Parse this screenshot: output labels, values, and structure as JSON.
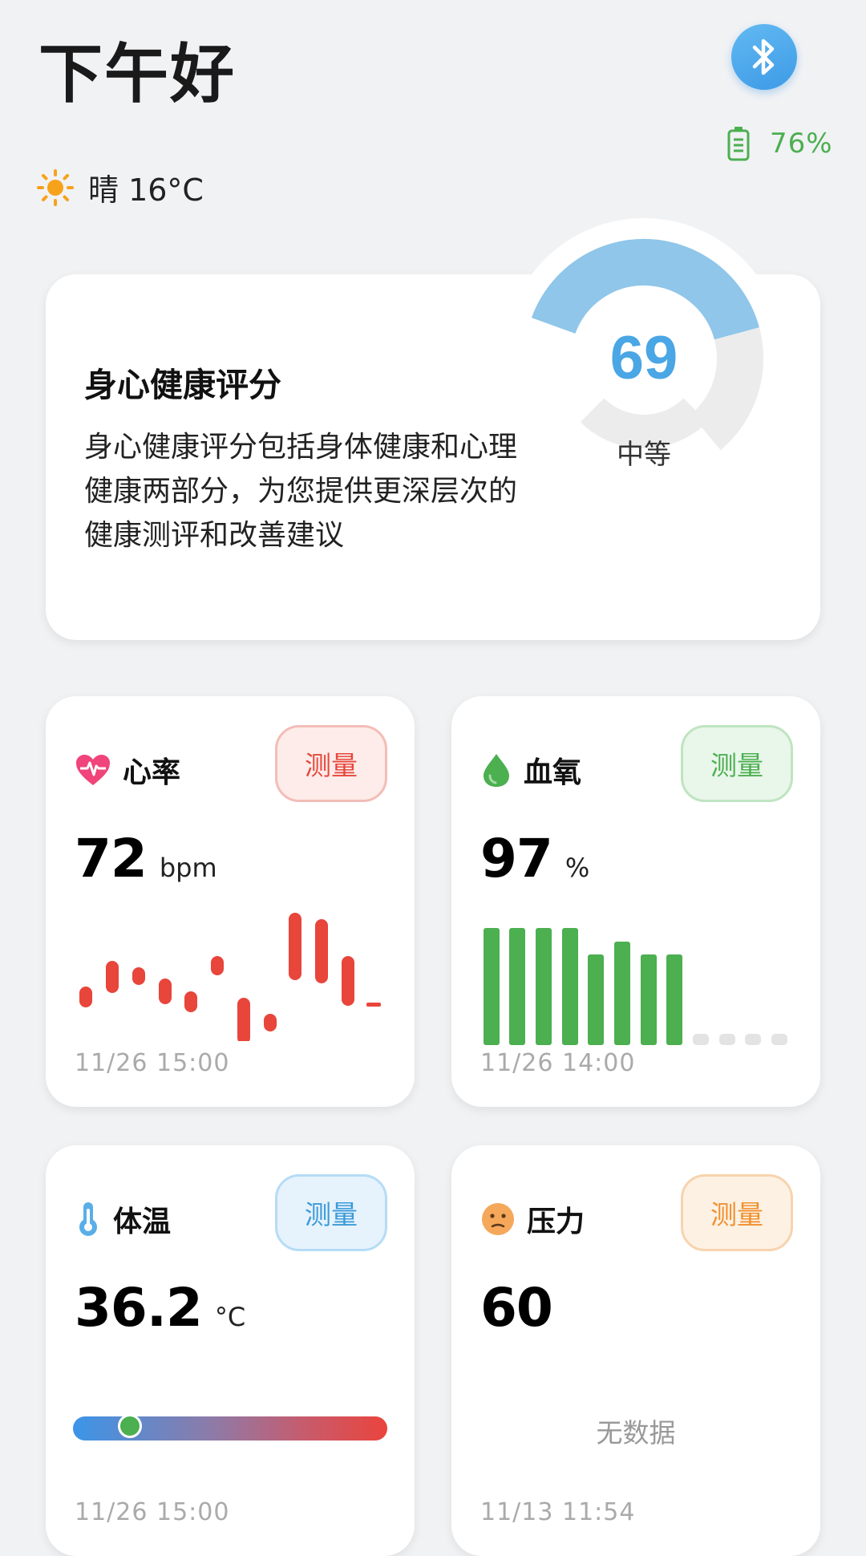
{
  "header": {
    "greeting": "下午好",
    "battery_percent": "76%",
    "weather_text": "晴 16°C"
  },
  "score_card": {
    "title": "身心健康评分",
    "description": "身心健康评分包括身体健康和心理健康两部分，为您提供更深层次的健康测评和改善建议",
    "score": "69",
    "score_value": 69,
    "level": "中等",
    "color": "#8fc6ea"
  },
  "heart_rate": {
    "label": "心率",
    "measure_label": "测量",
    "value": "72",
    "unit": "bpm",
    "time": "11/26 15:00",
    "color": "#e8453b"
  },
  "blood_oxygen": {
    "label": "血氧",
    "measure_label": "测量",
    "value": "97",
    "unit": "%",
    "time": "11/26 14:00",
    "color": "#4caf50"
  },
  "body_temp": {
    "label": "体温",
    "measure_label": "测量",
    "value": "36.2",
    "unit": "°C",
    "time": "11/26 15:00",
    "level_fraction": 0.18
  },
  "stress": {
    "label": "压力",
    "measure_label": "测量",
    "value": "60",
    "no_data": "无数据",
    "time": "11/13 11:54"
  }
}
